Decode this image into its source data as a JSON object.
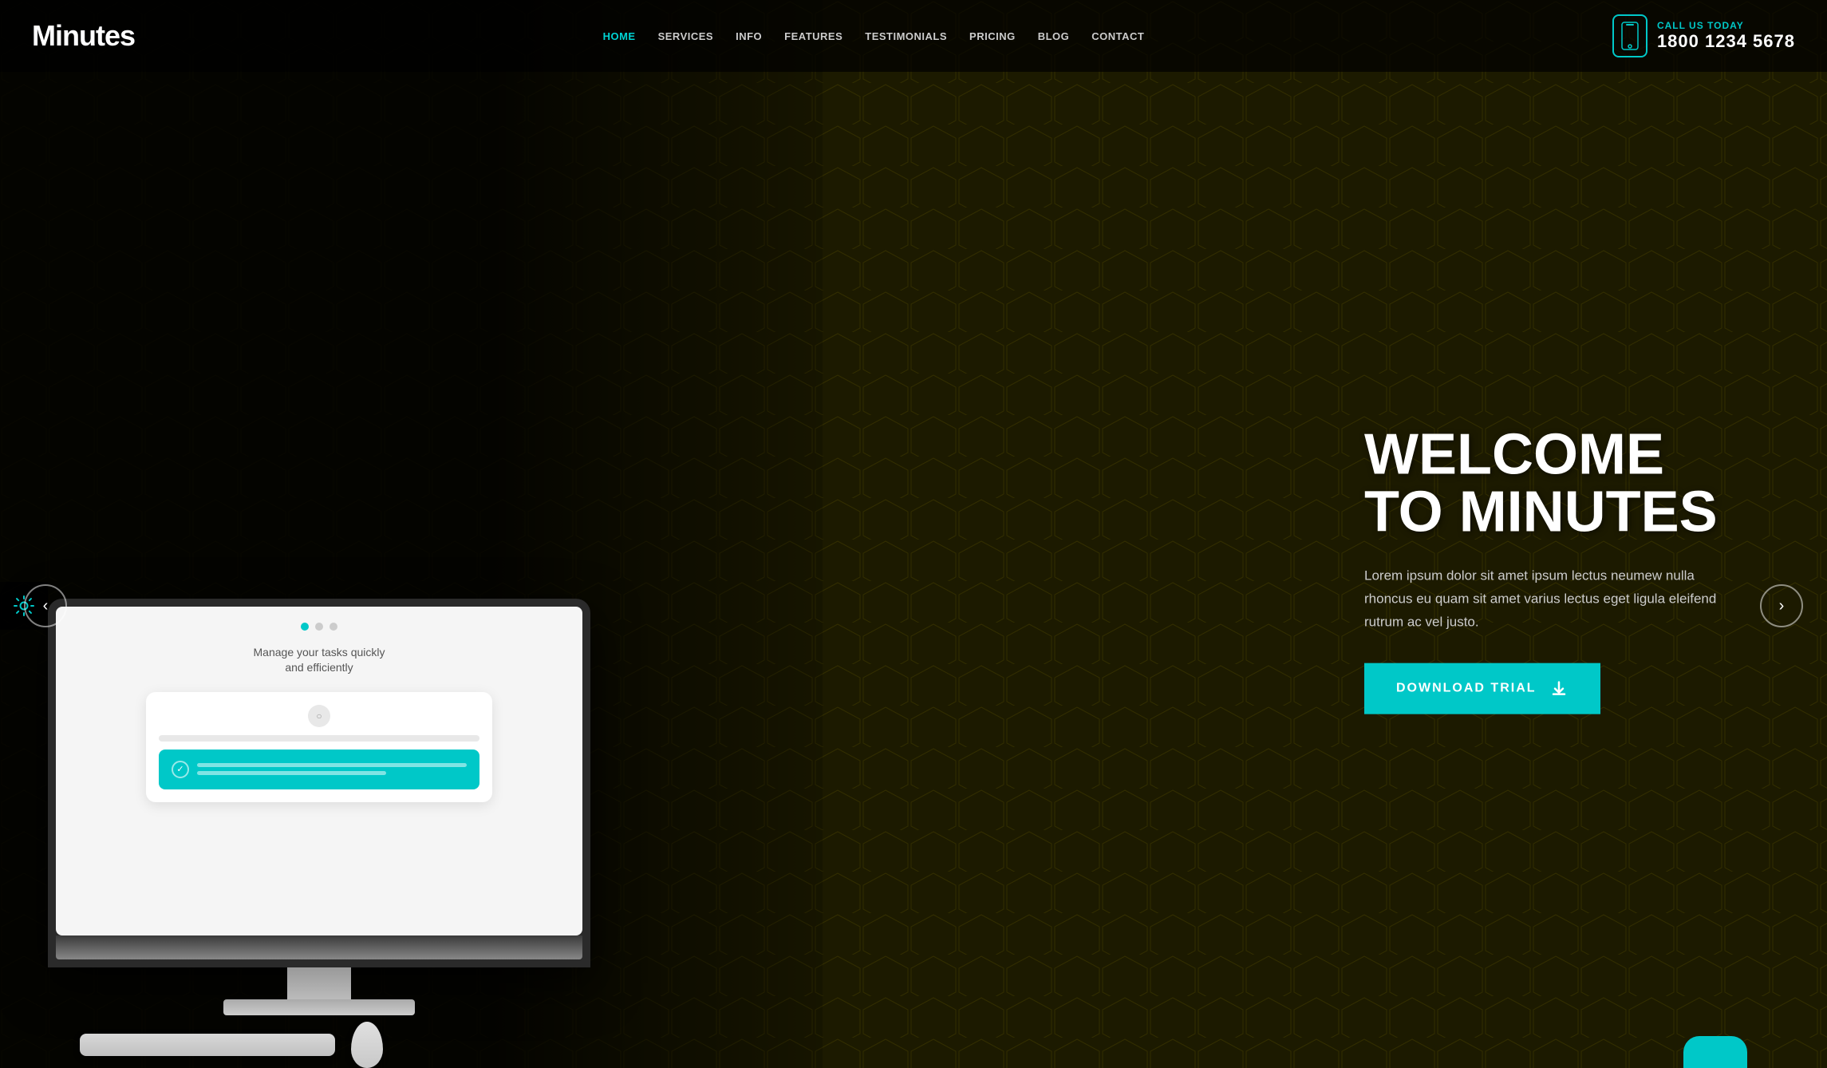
{
  "brand": {
    "logo": "Minutes"
  },
  "nav": {
    "links": [
      {
        "label": "HOME",
        "active": true,
        "id": "home"
      },
      {
        "label": "SERVICES",
        "active": false,
        "id": "services"
      },
      {
        "label": "INFO",
        "active": false,
        "id": "info"
      },
      {
        "label": "FEATURES",
        "active": false,
        "id": "features"
      },
      {
        "label": "TESTIMONIALS",
        "active": false,
        "id": "testimonials"
      },
      {
        "label": "PRICING",
        "active": false,
        "id": "pricing"
      },
      {
        "label": "BLOG",
        "active": false,
        "id": "blog"
      },
      {
        "label": "CONTACT",
        "active": false,
        "id": "contact"
      }
    ]
  },
  "phone": {
    "call_label": "CALL US TODAY",
    "number": "1800 1234 5678"
  },
  "hero": {
    "title_line1": "WELCOME",
    "title_line2": "TO MINUTES",
    "description": "Lorem ipsum dolor sit amet ipsum lectus neumew nulla rhoncus eu quam sit amet varius lectus eget ligula eleifend rutrum ac vel justo.",
    "cta_label": "DOWNLOAD TRIAL"
  },
  "screen": {
    "manage_text": "Manage your tasks quickly",
    "and_text": "and efficiently"
  },
  "carousel": {
    "prev_label": "‹",
    "next_label": "›"
  },
  "icons": {
    "phone": "📱",
    "gear": "⚙",
    "download": "↓",
    "check": "✓"
  }
}
